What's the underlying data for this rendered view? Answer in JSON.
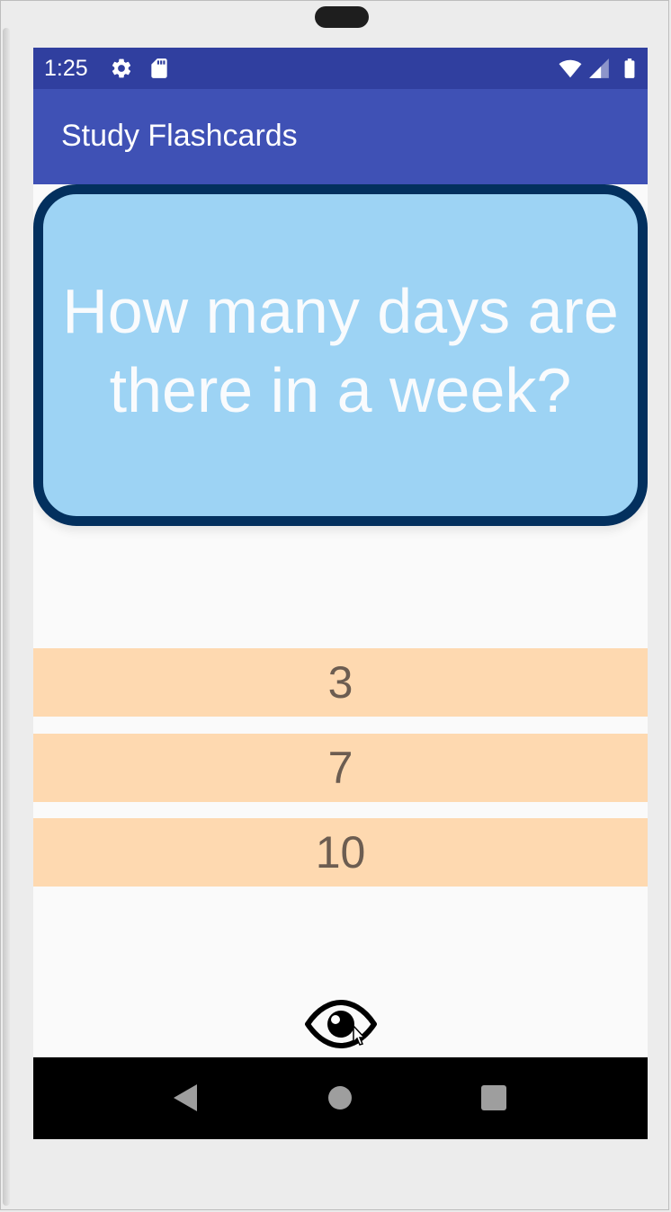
{
  "status_bar": {
    "time": "1:25",
    "icons": [
      "settings-icon",
      "sd-card-icon",
      "wifi-icon",
      "signal-icon",
      "battery-icon"
    ],
    "color": "#303f9f"
  },
  "app_bar": {
    "title": "Study Flashcards",
    "color": "#3f51b5"
  },
  "flashcard": {
    "question_line1": "How many days are",
    "question_line2": "there in a week?",
    "background": "#9dd3f4",
    "border_color": "#03305e"
  },
  "answers": [
    {
      "label": "3"
    },
    {
      "label": "7"
    },
    {
      "label": "10"
    }
  ],
  "answer_color": "#fed9b0",
  "toggle_answer_icon": "eye-icon",
  "nav_bar": {
    "buttons": [
      "back-icon",
      "home-icon",
      "recents-icon"
    ]
  }
}
